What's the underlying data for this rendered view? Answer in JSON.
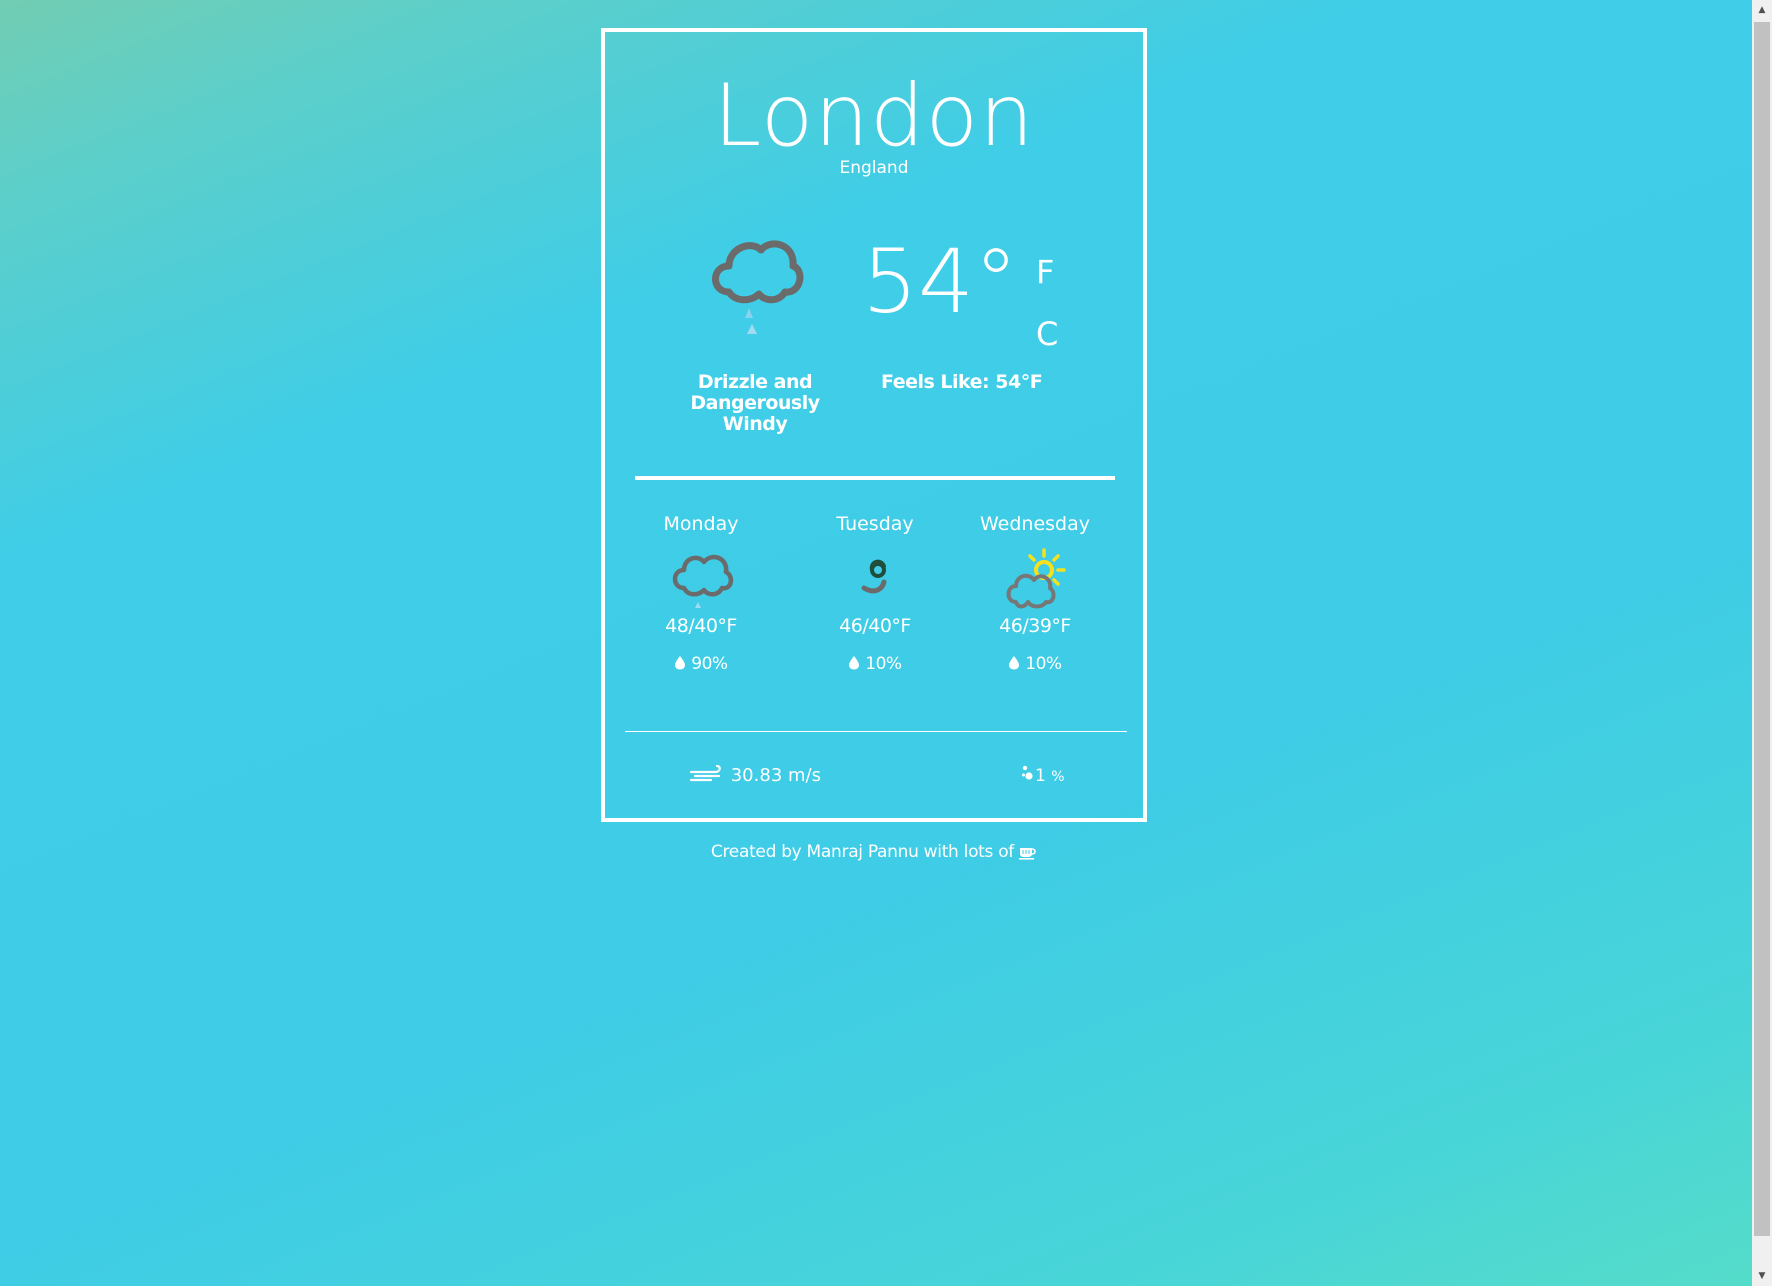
{
  "location": {
    "city": "London",
    "country": "England"
  },
  "current": {
    "temperature": "54°",
    "unit_f": "F",
    "unit_c": "C",
    "condition": "Drizzle and Dangerously Windy",
    "feels_like": "Feels Like: 54°F",
    "icon": "drizzle-cloud-icon"
  },
  "forecast": [
    {
      "day": "Monday",
      "range": "48/40°F",
      "rain": "90%",
      "icon": "drizzle-cloud-icon"
    },
    {
      "day": "Tuesday",
      "range": "46/40°F",
      "rain": "10%",
      "icon": "wind-icon"
    },
    {
      "day": "Wednesday",
      "range": "46/39°F",
      "rain": "10%",
      "icon": "partly-cloudy-icon"
    }
  ],
  "details": {
    "wind": "30.83 m/s",
    "humidity_value": "1",
    "humidity_unit": "%"
  },
  "footer": {
    "text": "Created by Manraj Pannu with lots of",
    "icon": "coffee-icon"
  },
  "colors": {
    "accent": "#3ecce6",
    "text": "#ffffff",
    "cloud": "#6b6b6b",
    "sun": "#f5e11f"
  }
}
